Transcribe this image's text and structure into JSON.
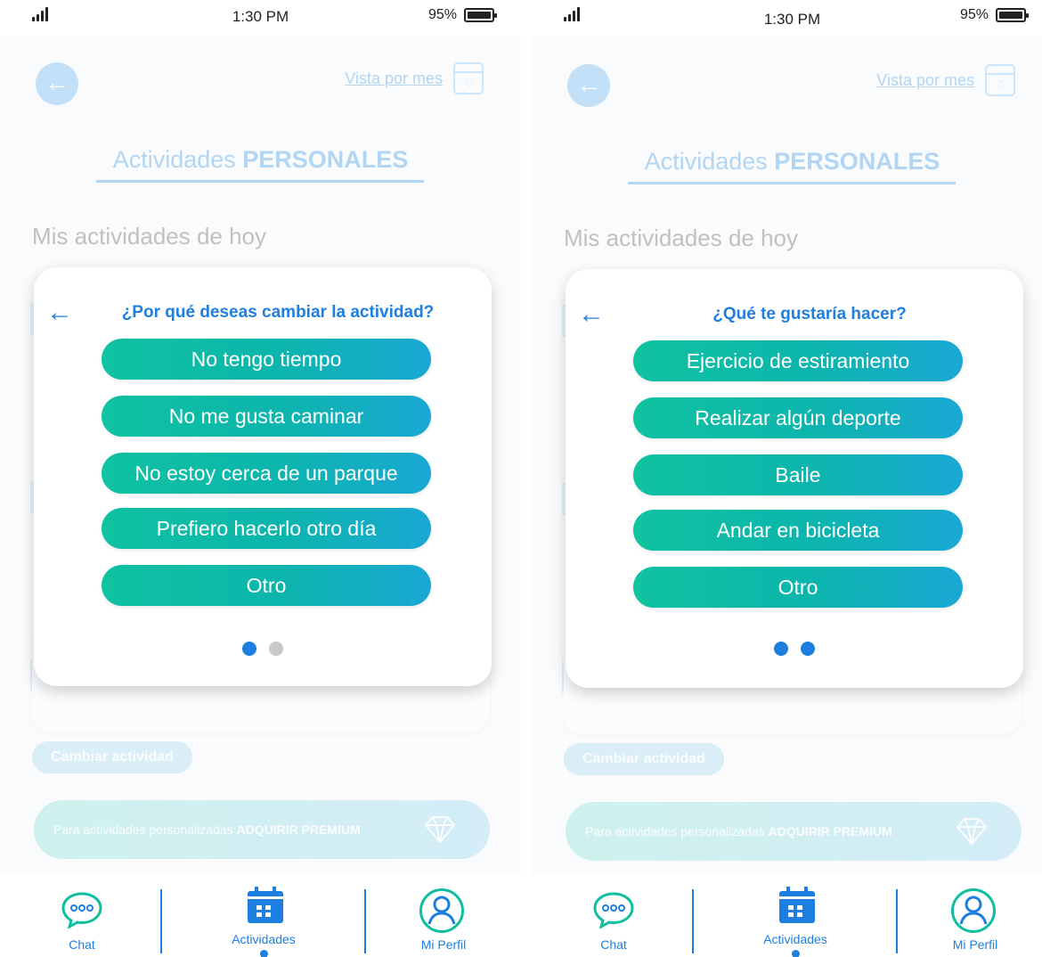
{
  "screens": [
    {
      "status": {
        "time": "1:30 PM",
        "battery": "95%"
      },
      "header": {
        "month_view": "Vista por mes"
      },
      "page_title": {
        "regular": "Actividades ",
        "bold": "PERSONALES"
      },
      "subheading": "Mis actividades de hoy",
      "modal": {
        "title": "¿Por qué deseas cambiar la actividad?",
        "options": [
          "No tengo tiempo",
          "No me gusta caminar",
          "No estoy cerca de un parque",
          "Prefiero hacerlo otro día",
          "Otro"
        ],
        "pager": {
          "current": 1,
          "total": 2
        }
      },
      "change_button": "Cambiar actividad",
      "premium": {
        "text": "Para actividades personalizadas ",
        "bold": "ADQUIRIR PREMIUM"
      },
      "nav": {
        "chat": "Chat",
        "activities": "Actividades",
        "profile": "Mi Perfil",
        "active": "activities"
      }
    },
    {
      "status": {
        "time": "1:30 PM",
        "battery": "95%"
      },
      "header": {
        "month_view": "Vista por mes"
      },
      "page_title": {
        "regular": "Actividades ",
        "bold": "PERSONALES"
      },
      "subheading": "Mis actividades de hoy",
      "modal": {
        "title": "¿Qué te gustaría hacer?",
        "options": [
          "Ejercicio de estiramiento",
          "Realizar algún deporte",
          "Baile",
          "Andar en bicicleta",
          "Otro"
        ],
        "pager": {
          "current": 2,
          "total": 2
        }
      },
      "change_button": "Cambiar actividad",
      "premium": {
        "text": "Para actividades personalizadas ",
        "bold": "ADQUIRIR PREMIUM"
      },
      "nav": {
        "chat": "Chat",
        "activities": "Actividades",
        "profile": "Mi Perfil",
        "active": "activities"
      }
    }
  ],
  "colors": {
    "accent_blue": "#1e7fe0",
    "option_teal": "#0fc2a0",
    "option_blue": "#1aa8d4",
    "dot_inactive": "#c9c9c9"
  },
  "icons": {
    "back": "arrow-left-icon",
    "calendar": "calendar-heart-icon",
    "chat": "chat-bubble-icon",
    "activities": "calendar-icon",
    "profile": "user-circle-icon",
    "premium": "diamond-icon"
  }
}
